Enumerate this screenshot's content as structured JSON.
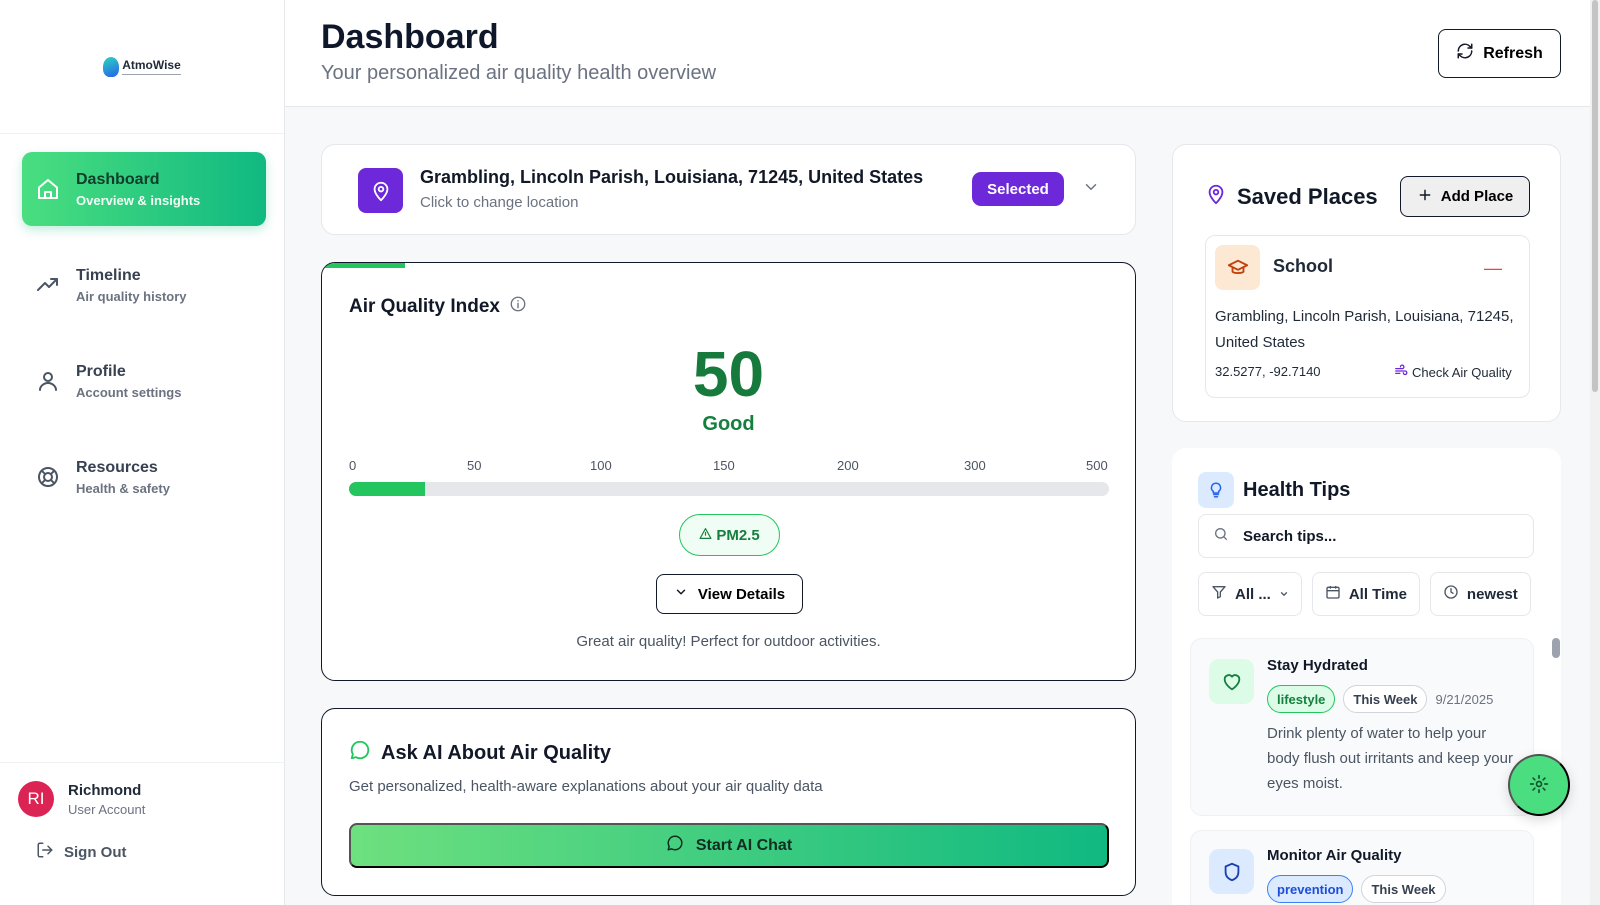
{
  "app": {
    "logo_text": "AtmoWise"
  },
  "sidebar": {
    "items": [
      {
        "label": "Dashboard",
        "sub": "Overview & insights",
        "active": true,
        "icon": "home-icon"
      },
      {
        "label": "Timeline",
        "sub": "Air quality history",
        "active": false,
        "icon": "trend-icon"
      },
      {
        "label": "Profile",
        "sub": "Account settings",
        "active": false,
        "icon": "user-icon"
      },
      {
        "label": "Resources",
        "sub": "Health & safety",
        "active": false,
        "icon": "lifebuoy-icon"
      }
    ],
    "user": {
      "initials": "RI",
      "name": "Richmond",
      "role": "User Account"
    },
    "sign_out": "Sign Out"
  },
  "header": {
    "title": "Dashboard",
    "subtitle": "Your personalized air quality health overview",
    "refresh_label": "Refresh"
  },
  "location": {
    "title": "Grambling, Lincoln Parish, Louisiana, 71245, United States",
    "sub": "Click to change location",
    "badge": "Selected"
  },
  "aqi": {
    "title": "Air Quality Index",
    "value": "50",
    "category": "Good",
    "scale": [
      "0",
      "50",
      "100",
      "150",
      "200",
      "300",
      "500"
    ],
    "progress_fraction": 0.1,
    "pollutant": "PM2.5",
    "view_details": "View Details",
    "message": "Great air quality! Perfect for outdoor activities."
  },
  "ai": {
    "title": "Ask AI About Air Quality",
    "sub": "Get personalized, health-aware explanations about your air quality data",
    "button": "Start AI Chat"
  },
  "saved_places": {
    "title": "Saved Places",
    "add_label": "Add Place",
    "places": [
      {
        "name": "School",
        "address": "Grambling, Lincoln Parish, Louisiana, 71245, United States",
        "coords": "32.5277, -92.7140",
        "check_label": "Check Air Quality"
      }
    ]
  },
  "health_tips": {
    "title": "Health Tips",
    "search_placeholder": "Search tips...",
    "filters": {
      "category": "All ...",
      "time": "All Time",
      "sort": "newest"
    },
    "tips": [
      {
        "title": "Stay Hydrated",
        "tag": "lifestyle",
        "period": "This Week",
        "date": "9/21/2025",
        "text": "Drink plenty of water to help your body flush out irritants and keep your eyes moist."
      },
      {
        "title": "Monitor Air Quality",
        "tag": "prevention",
        "period": "This Week"
      }
    ]
  },
  "colors": {
    "accent_green": "#22c55e",
    "brand_purple": "#6d28d9",
    "aqi_good": "#157a3b"
  }
}
